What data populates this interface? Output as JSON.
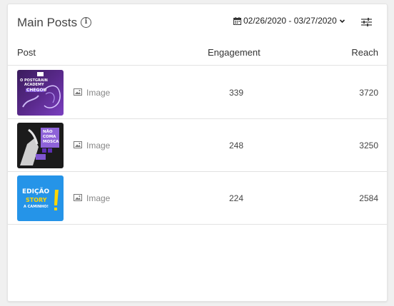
{
  "header": {
    "title": "Main Posts",
    "info_glyph": "i",
    "date_range": "02/26/2020 - 03/27/2020",
    "calendar_icon": "calendar-icon",
    "dropdown_icon": "chevron-down-icon",
    "filter_icon": "sliders-icon"
  },
  "table": {
    "columns": [
      "Post",
      "Engagement",
      "Reach"
    ],
    "rows": [
      {
        "type": "Image",
        "engagement": "339",
        "reach": "3720",
        "thumb_lines": [
          "O POSTGRAIN",
          "ACADEMY",
          "CHEGOU"
        ]
      },
      {
        "type": "Image",
        "engagement": "248",
        "reach": "3250",
        "thumb_lines": [
          "NÃO",
          "COMA",
          "MOSCA"
        ]
      },
      {
        "type": "Image",
        "engagement": "224",
        "reach": "2584",
        "thumb_lines": [
          "EDIÇÃO",
          "STORY",
          "A CAMINHO!"
        ]
      }
    ]
  },
  "colors": {
    "accent_purple": "#5b2a8e",
    "accent_blue": "#2594e8",
    "accent_yellow": "#ffd600"
  }
}
